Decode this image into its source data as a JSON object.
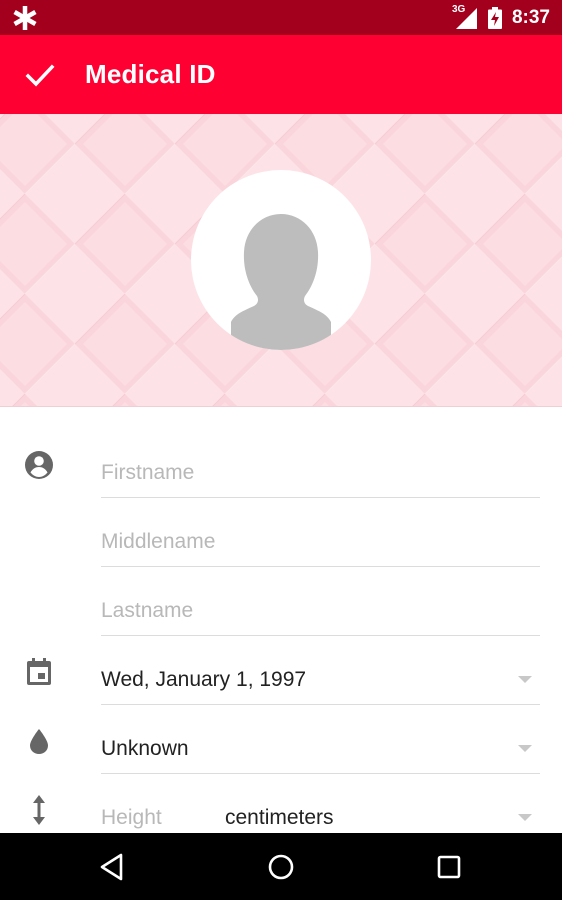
{
  "status_bar": {
    "network_label": "3G",
    "time": "8:37"
  },
  "app_bar": {
    "title": "Medical ID"
  },
  "form": {
    "firstname": {
      "placeholder": "Firstname",
      "value": ""
    },
    "middlename": {
      "placeholder": "Middlename",
      "value": ""
    },
    "lastname": {
      "placeholder": "Lastname",
      "value": ""
    },
    "birthdate": {
      "value": "Wed, January 1, 1997"
    },
    "blood_type": {
      "value": "Unknown"
    },
    "height": {
      "placeholder": "Height",
      "unit": "centimeters"
    }
  },
  "icons": {
    "app": "asterisk-icon",
    "confirm": "checkmark-icon",
    "person": "account-circle-icon",
    "calendar": "calendar-icon",
    "blood": "drop-icon",
    "height": "vertical-arrows-icon",
    "back": "back-triangle-icon",
    "home": "home-circle-icon",
    "recents": "recents-square-icon"
  },
  "colors": {
    "status_bar": "#a3001d",
    "app_bar": "#ff0033",
    "hero_bg": "#fde3e7",
    "placeholder": "#b8b8b8",
    "text": "#222222",
    "icon": "#666666"
  }
}
